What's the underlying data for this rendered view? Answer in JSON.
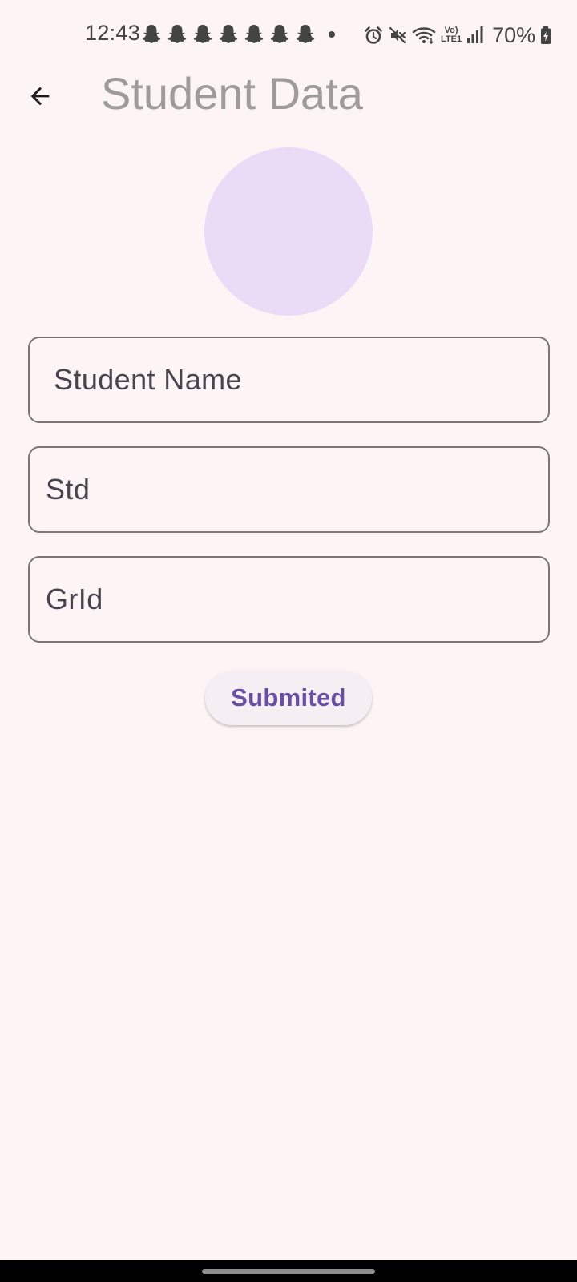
{
  "status_bar": {
    "time": "12:43",
    "notification_icons": [
      "snapchat-icon",
      "snapchat-icon",
      "snapchat-icon",
      "snapchat-icon",
      "snapchat-icon",
      "snapchat-icon",
      "snapchat-icon"
    ],
    "network_label_top": "Vo)",
    "network_label_bottom": "LTE1",
    "battery_text": "70%"
  },
  "app_bar": {
    "title": "Student Data"
  },
  "form": {
    "student_name_placeholder": "Student Name",
    "std_placeholder": "Std",
    "grid_placeholder": "GrId",
    "submit_label": "Submited"
  },
  "colors": {
    "background": "#fdf5f5",
    "avatar": "#eadcf7",
    "accent": "#6750a4",
    "title": "#9e9b9b"
  }
}
